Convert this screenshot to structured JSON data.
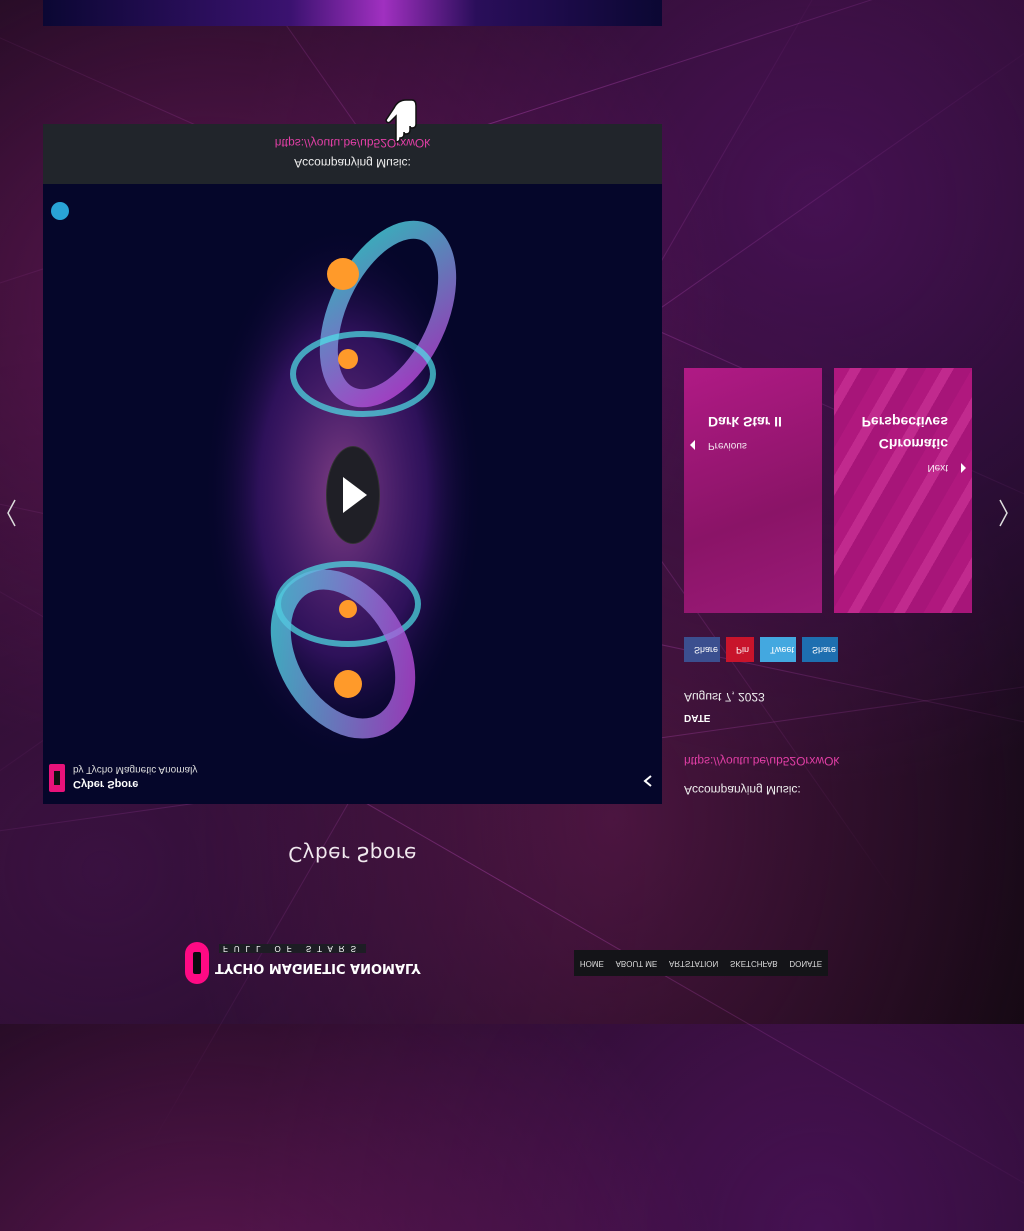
{
  "caption": {
    "label": "Accompanying Music:",
    "link": "https://youtu.be/ub52OrxwOk"
  },
  "video": {
    "title": "Cyber Spore",
    "byline": "by Tycho Magnetic Anomaly"
  },
  "page": {
    "title": "Cyber Spore"
  },
  "nav": {
    "prev": {
      "label": "Previous",
      "title": "Dark Star II"
    },
    "next": {
      "label": "Next",
      "title_line1": "Chromatic",
      "title_line2": "Perspectives"
    }
  },
  "share": {
    "facebook": "Share",
    "pinterest": "Pin",
    "twitter": "Tweet",
    "linkedin": "Share"
  },
  "meta": {
    "date_label": "DATE",
    "date": "August 7, 2023",
    "music_label": "Accompanying Music:",
    "music_link": "https://youtu.be/ub52OrxwOk"
  },
  "footer": {
    "logo_name": "TYCHO MAGNETIC ANOMALY",
    "logo_tagline": "FULL OF STARS",
    "nav": [
      "HOME",
      "ABOUT ME",
      "ARTSTATION",
      "SKETCHFAB",
      "DONATE"
    ]
  },
  "colors": {
    "accent_pink": "#e8127a",
    "link_pink": "#e23fa6",
    "card_magenta": "#a3177c"
  },
  "icons": [
    "hand-pointer-icon",
    "play-icon",
    "share-icon",
    "chevron-left-icon",
    "chevron-right-icon",
    "facebook-icon",
    "pinterest-icon",
    "twitter-icon",
    "linkedin-icon"
  ]
}
